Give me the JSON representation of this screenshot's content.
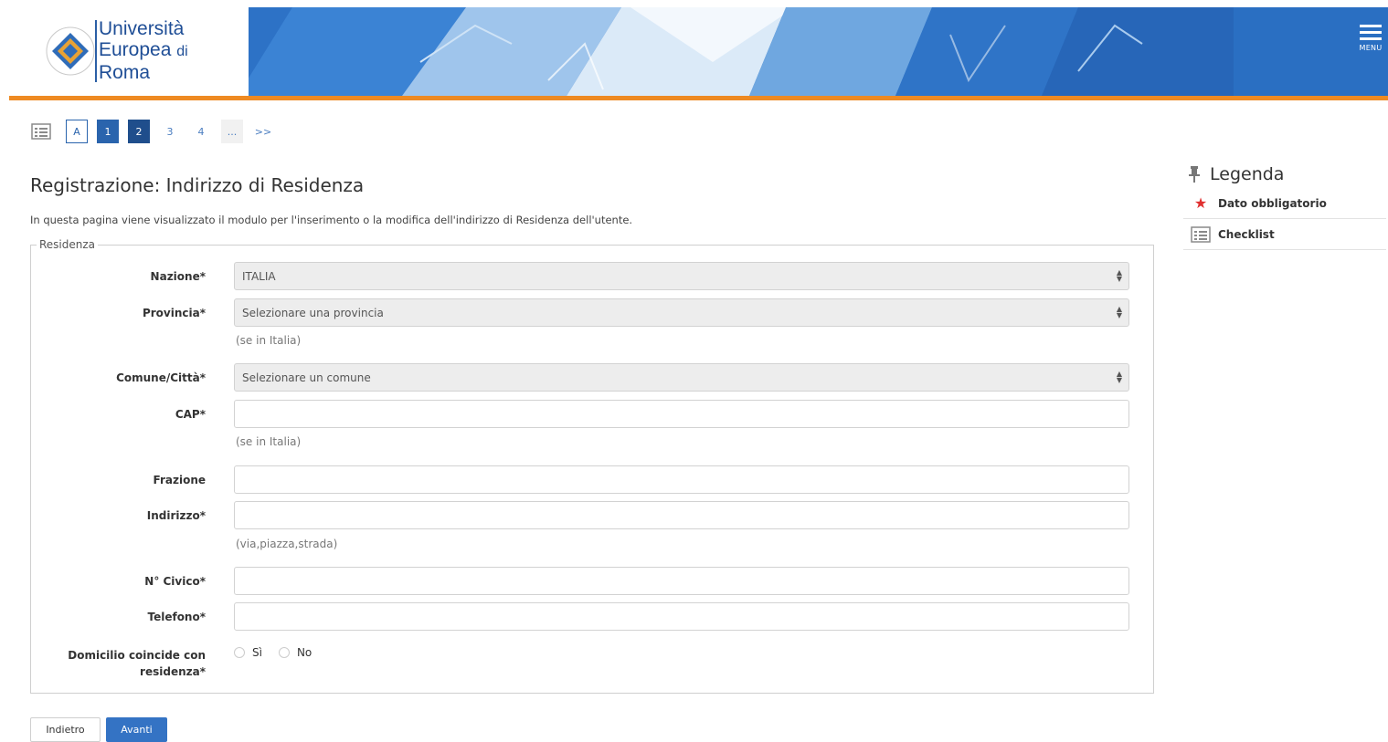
{
  "header": {
    "logo_line1": "Università",
    "logo_line2": "Europea",
    "logo_line2_suffix": "di",
    "logo_line3": "Roma",
    "menu_label": "MENU"
  },
  "pager": {
    "steps": [
      "A",
      "1",
      "2",
      "3",
      "4",
      "...",
      ">>"
    ]
  },
  "page": {
    "title": "Registrazione: Indirizzo di Residenza",
    "description": "In questa pagina viene visualizzato il modulo per l'inserimento o la modifica dell'indirizzo di Residenza dell'utente."
  },
  "form": {
    "legend": "Residenza",
    "nazione_label": "Nazione*",
    "nazione_value": "ITALIA",
    "provincia_label": "Provincia*",
    "provincia_value": "Selezionare una provincia",
    "provincia_hint": "(se in Italia)",
    "comune_label": "Comune/Città*",
    "comune_value": "Selezionare un comune",
    "cap_label": "CAP*",
    "cap_hint": "(se in Italia)",
    "frazione_label": "Frazione",
    "indirizzo_label": "Indirizzo*",
    "indirizzo_hint": "(via,piazza,strada)",
    "civico_label": "N° Civico*",
    "telefono_label": "Telefono*",
    "domicilio_label_1": "Domicilio coincide con",
    "domicilio_label_2": "residenza*",
    "opt_si": "Sì",
    "opt_no": "No"
  },
  "buttons": {
    "back": "Indietro",
    "next": "Avanti"
  },
  "legend_panel": {
    "title": "Legenda",
    "required": "Dato obbligatorio",
    "checklist": "Checklist"
  },
  "colors": {
    "primary": "#2a64ad",
    "accent_orange": "#ee8a22",
    "required_star": "#e03030"
  }
}
